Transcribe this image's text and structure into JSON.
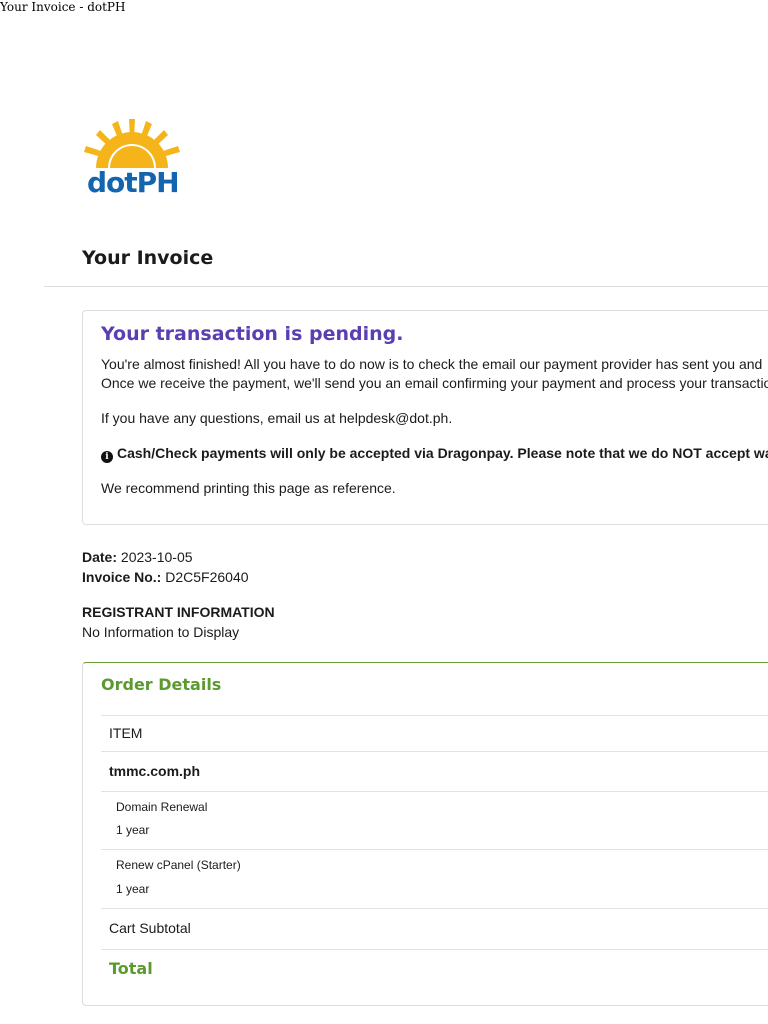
{
  "window": {
    "title": "Your Invoice - dotPH"
  },
  "logo": {
    "text": "dotPH",
    "sun_color": "#f5b51a",
    "text_color": "#1465b0"
  },
  "page": {
    "heading": "Your Invoice"
  },
  "pending": {
    "title": "Your transaction is pending.",
    "line1": "You're almost finished! All you have to do now is to check the email our payment provider has sent you and",
    "line2": "Once we receive the payment, we'll send you an email confirming your payment and process your transaction.",
    "questions": "If you have any questions, email us at helpdesk@dot.ph.",
    "notice": "Cash/Check payments will only be accepted via Dragonpay. Please note that we do NOT accept walk-in payments.",
    "recommend": "We recommend printing this page as reference.",
    "title_color": "#5a3fb0"
  },
  "invoice": {
    "date_label": "Date:",
    "date_value": "2023-10-05",
    "number_label": "Invoice No.:",
    "number_value": "D2C5F26040"
  },
  "registrant": {
    "heading": "REGISTRANT INFORMATION",
    "value": "No Information to Display"
  },
  "order": {
    "title": "Order Details",
    "column_item": "ITEM",
    "domain": "tmmc.com.ph",
    "lines": [
      {
        "name": "Domain Renewal",
        "term": "1 year"
      },
      {
        "name": "Renew cPanel (Starter)",
        "term": "1 year"
      }
    ],
    "subtotal_label": "Cart Subtotal",
    "total_label": "Total",
    "accent_color": "#5b9a2e"
  }
}
